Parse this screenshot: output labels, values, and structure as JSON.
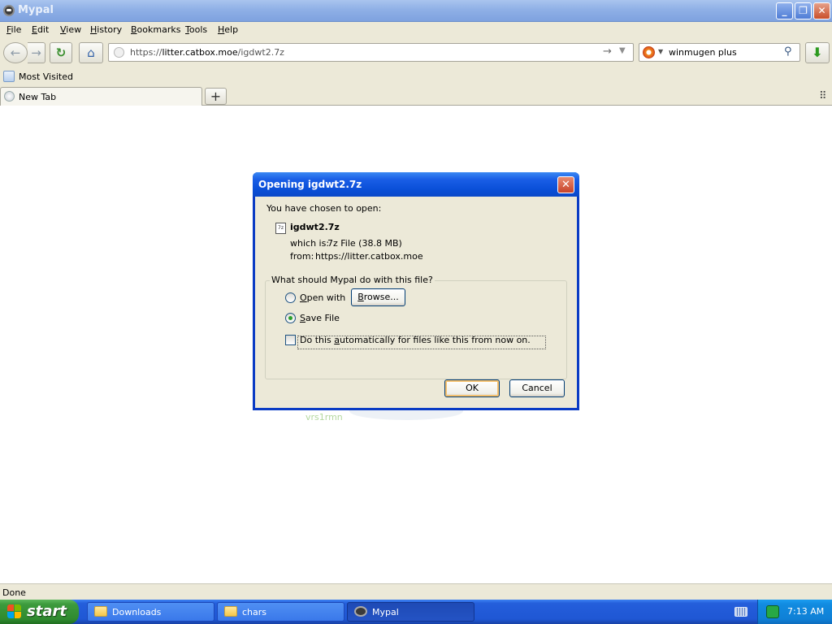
{
  "window": {
    "title": "Mypal",
    "minimize_glyph": "_",
    "maximize_glyph": "❐",
    "close_glyph": "✕"
  },
  "menubar": [
    {
      "label": "File",
      "accel": "F",
      "rest": "ile"
    },
    {
      "label": "Edit",
      "accel": "E",
      "rest": "dit"
    },
    {
      "label": "View",
      "accel": "V",
      "rest": "iew"
    },
    {
      "label": "History",
      "accel": "H",
      "rest": "istory"
    },
    {
      "label": "Bookmarks",
      "accel": "B",
      "rest": "ookmarks"
    },
    {
      "label": "Tools",
      "accel": "T",
      "rest": "ools"
    },
    {
      "label": "Help",
      "accel": "H",
      "rest": "elp"
    }
  ],
  "toolbar": {
    "back_glyph": "←",
    "forward_glyph": "→",
    "reload_glyph": "↻",
    "home_glyph": "⌂",
    "url_prefix": "https://",
    "url_host": "litter.catbox.moe",
    "url_path": "/igdwt2.7z",
    "go_glyph": "→",
    "dropmarker_glyph": "▼",
    "search_value": "winmugen plus",
    "search_glyph": "⚲",
    "downloads_glyph": "⬇"
  },
  "bookmarks": {
    "most_visited": "Most Visited"
  },
  "tabs": {
    "items": [
      {
        "label": "New Tab"
      }
    ],
    "new_tab_glyph": "+",
    "list_all_glyph": "⠿"
  },
  "content": {
    "background_text": "vrs1rmn"
  },
  "dialog": {
    "title": "Opening igdwt2.7z",
    "close_glyph": "✕",
    "intro": "You have chosen to open:",
    "file_name": "igdwt2.7z",
    "which_is_label": "which is:",
    "which_is_value": "7z File (38.8 MB)",
    "from_label": "from:",
    "from_value": "https://litter.catbox.moe",
    "question": "What should Mypal do with this file?",
    "open_with_accel": "O",
    "open_with_rest": "pen with",
    "browse_accel": "B",
    "browse_rest": "rowse...",
    "save_file_accel": "S",
    "save_file_rest": "ave File",
    "selected_option": "Save File",
    "auto_pre": "Do this ",
    "auto_accel": "a",
    "auto_rest": "utomatically for files like this from now on.",
    "auto_checked": false,
    "ok_label": "OK",
    "cancel_label": "Cancel"
  },
  "statusbar": {
    "text": "Done"
  },
  "taskbar": {
    "start_label": "start",
    "buttons": [
      {
        "label": "Downloads",
        "icon": "folder-icon",
        "active": false
      },
      {
        "label": "chars",
        "icon": "folder-icon",
        "active": false
      },
      {
        "label": "Mypal",
        "icon": "mypal-icon",
        "active": true
      }
    ],
    "clock": "7:13 AM"
  },
  "colors": {
    "xp_blue": "#245edb",
    "start_green": "#3c9a3c",
    "dialog_face": "#ece9d8",
    "ok_focus": "#f5c16f"
  }
}
